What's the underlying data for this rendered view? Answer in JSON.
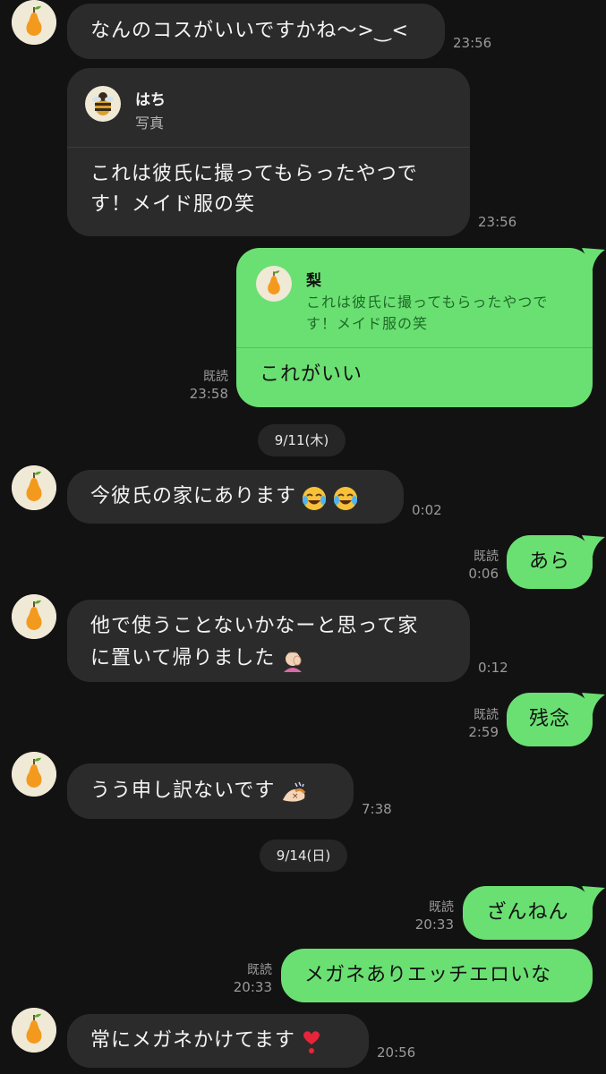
{
  "messages": {
    "m1": {
      "text": "なんのコスがいいですかね〜>‿<",
      "time": "23:56"
    },
    "m2": {
      "quote_name": "はち",
      "quote_text": "写真",
      "line1": "これは彼氏に撮ってもらったやつで",
      "line2": "す！メイド服の笑",
      "time": "23:56"
    },
    "m3": {
      "quote_name": "梨",
      "quote_line1": "これは彼氏に撮ってもらったやつで",
      "quote_line2": "す！メイド服の笑",
      "text": "これがいい",
      "read": "既読",
      "time": "23:58"
    },
    "date1": "9/11(木)",
    "m4": {
      "text": "今彼氏の家にあります",
      "time": "0:02"
    },
    "m5": {
      "text": "あら",
      "read": "既読",
      "time": "0:06"
    },
    "m6": {
      "line1": "他で使うことないかなーと思って家",
      "line2": "に置いて帰りました",
      "time": "0:12"
    },
    "m7": {
      "text": "残念",
      "read": "既読",
      "time": "2:59"
    },
    "m8": {
      "text": "うう申し訳ないです",
      "time": "7:38"
    },
    "date2": "9/14(日)",
    "m9": {
      "text": "ざんねん",
      "read": "既読",
      "time": "20:33"
    },
    "m10": {
      "text": "メガネありエッチエロいな",
      "read": "既読",
      "time": "20:33"
    },
    "m11": {
      "text": "常にメガネかけてます",
      "time": "20:56"
    }
  },
  "icons": {
    "contact_avatar": "pear-icon",
    "quote_avatar": "bee-icon",
    "emojis": [
      "tears-of-joy-emoji",
      "tears-of-joy-emoji",
      "facepalm-emoji",
      "dogeza-emoji",
      "heart-exclamation-emoji"
    ]
  },
  "colors": {
    "background": "#121212",
    "incoming_bubble": "#2b2b2b",
    "outgoing_bubble": "#6ae072",
    "quote_accent_text": "#1f6b27"
  }
}
